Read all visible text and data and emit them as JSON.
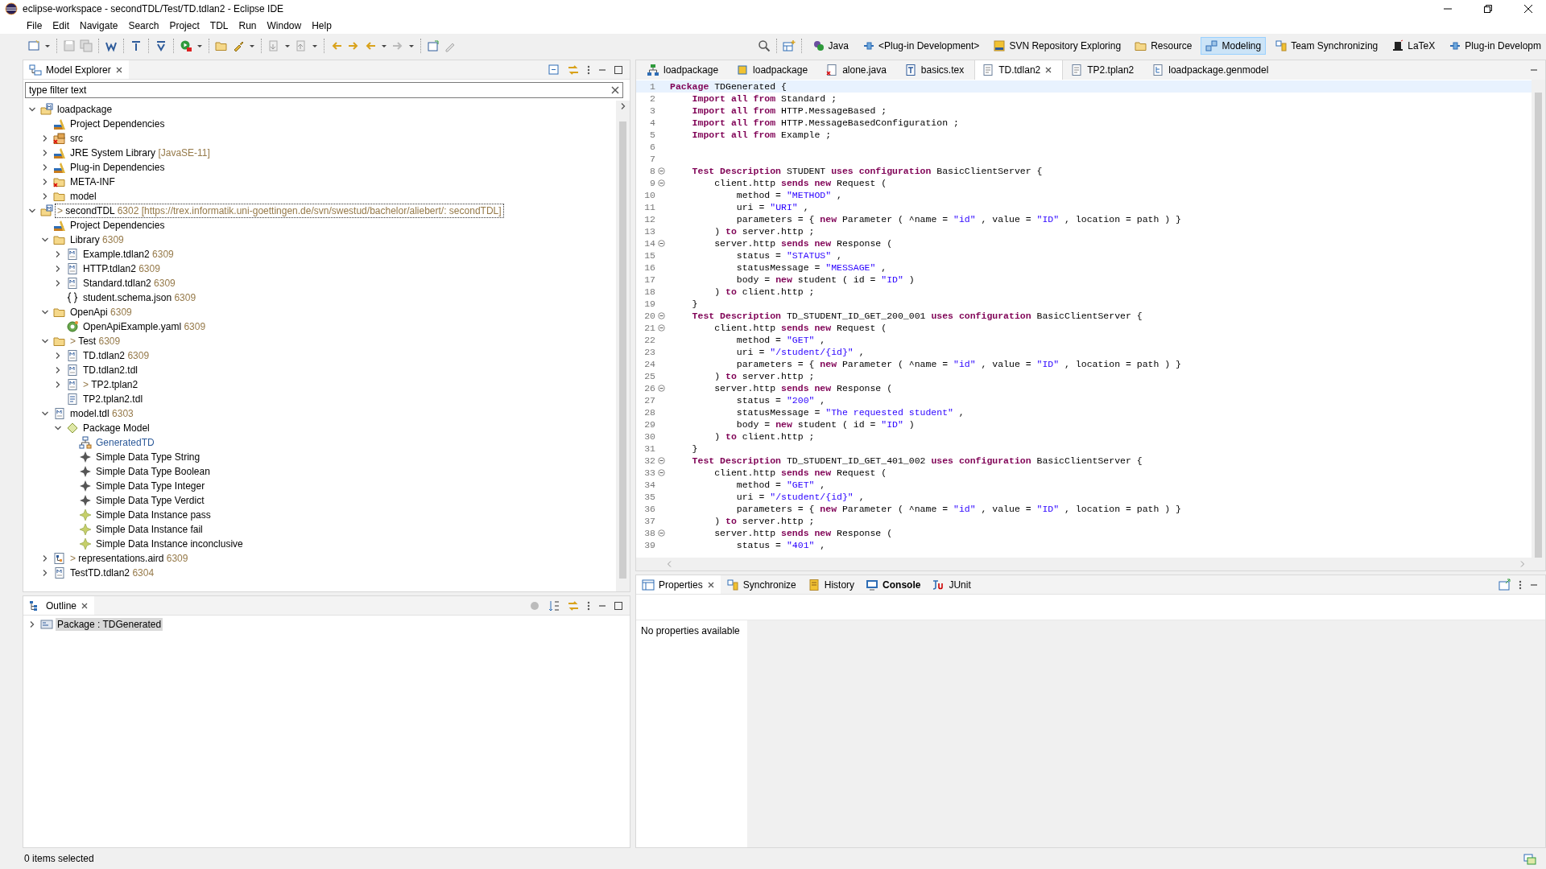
{
  "window": {
    "title": "eclipse-workspace - secondTDL/Test/TD.tdlan2 - Eclipse IDE"
  },
  "menu": [
    "File",
    "Edit",
    "Navigate",
    "Search",
    "Project",
    "TDL",
    "Run",
    "Window",
    "Help"
  ],
  "perspectives": [
    {
      "label": "Java",
      "selected": false
    },
    {
      "label": "<Plug-in Development>",
      "selected": false
    },
    {
      "label": "SVN Repository Exploring",
      "selected": false
    },
    {
      "label": "Resource",
      "selected": false
    },
    {
      "label": "Modeling",
      "selected": true
    },
    {
      "label": "Team Synchronizing",
      "selected": false
    },
    {
      "label": "LaTeX",
      "selected": false
    },
    {
      "label": "Plug-in Developm",
      "selected": false
    }
  ],
  "explorer": {
    "title": "Model Explorer",
    "filter": {
      "value": "type filter text"
    },
    "tree": [
      {
        "label": "loadpackage",
        "kind": "project",
        "has_children": true,
        "expanded": true,
        "selected": false,
        "children": [
          {
            "label": "Project Dependencies",
            "kind": "library",
            "has_children": false,
            "selected": false
          },
          {
            "label": "src",
            "kind": "src",
            "has_children": true,
            "expanded": false,
            "selected": false
          },
          {
            "label": "JRE System Library",
            "decoration": "[JavaSE-11]",
            "kind": "library",
            "has_children": true,
            "expanded": false,
            "selected": false
          },
          {
            "label": "Plug-in Dependencies",
            "kind": "library",
            "has_children": true,
            "expanded": false,
            "selected": false
          },
          {
            "label": "META-INF",
            "kind": "folder-error",
            "has_children": true,
            "expanded": false,
            "selected": false
          },
          {
            "label": "model",
            "kind": "folder",
            "has_children": true,
            "expanded": false,
            "selected": false
          }
        ]
      },
      {
        "label": "secondTDL",
        "marker": ">",
        "decoration": "6302 [https://trex.informatik.uni-goettingen.de/svn/swestud/bachelor/aliebert/: secondTDL]",
        "kind": "project",
        "has_children": true,
        "expanded": true,
        "selected": true,
        "children": [
          {
            "label": "Project Dependencies",
            "kind": "library",
            "has_children": false,
            "selected": false
          },
          {
            "label": "Library",
            "decoration": "6309",
            "kind": "folder",
            "has_children": true,
            "expanded": true,
            "selected": false,
            "children": [
              {
                "label": "Example.tdlan2",
                "decoration": "6309",
                "kind": "model",
                "has_children": true,
                "expanded": false,
                "selected": false
              },
              {
                "label": "HTTP.tdlan2",
                "decoration": "6309",
                "kind": "model",
                "has_children": true,
                "expanded": false,
                "selected": false
              },
              {
                "label": "Standard.tdlan2",
                "decoration": "6309",
                "kind": "model",
                "has_children": true,
                "expanded": false,
                "selected": false
              },
              {
                "label": "student.schema.json",
                "decoration": "6309",
                "kind": "json",
                "has_children": false,
                "selected": false
              }
            ]
          },
          {
            "label": "OpenApi",
            "decoration": "6309",
            "kind": "folder",
            "has_children": true,
            "expanded": true,
            "selected": false,
            "children": [
              {
                "label": "OpenApiExample.yaml",
                "decoration": "6309",
                "kind": "yaml",
                "has_children": false,
                "selected": false
              }
            ]
          },
          {
            "label": "Test",
            "marker": ">",
            "decoration": "6309",
            "kind": "folder",
            "has_children": true,
            "expanded": true,
            "selected": false,
            "children": [
              {
                "label": "TD.tdlan2",
                "decoration": "6309",
                "kind": "model",
                "has_children": true,
                "expanded": false,
                "selected": false
              },
              {
                "label": "TD.tdlan2.tdl",
                "kind": "model",
                "has_children": true,
                "expanded": false,
                "selected": false
              },
              {
                "label": "TP2.tplan2",
                "marker": ">",
                "kind": "model",
                "has_children": true,
                "expanded": false,
                "selected": false
              },
              {
                "label": "TP2.tplan2.tdl",
                "kind": "text",
                "has_children": false,
                "selected": false
              }
            ]
          },
          {
            "label": "model.tdl",
            "decoration": "6303",
            "kind": "model",
            "has_children": true,
            "expanded": true,
            "selected": false,
            "children": [
              {
                "label": "Package Model",
                "kind": "package",
                "has_children": true,
                "expanded": true,
                "selected": false,
                "children": [
                  {
                    "label": "GeneratedTD",
                    "kind": "diagram",
                    "has_children": false,
                    "selected": false
                  },
                  {
                    "label": "Simple Data Type String",
                    "kind": "datatype",
                    "has_children": false,
                    "selected": false
                  },
                  {
                    "label": "Simple Data Type Boolean",
                    "kind": "datatype",
                    "has_children": false,
                    "selected": false
                  },
                  {
                    "label": "Simple Data Type Integer",
                    "kind": "datatype",
                    "has_children": false,
                    "selected": false
                  },
                  {
                    "label": "Simple Data Type Verdict",
                    "kind": "datatype",
                    "has_children": false,
                    "selected": false
                  },
                  {
                    "label": "Simple Data Instance pass",
                    "kind": "instance",
                    "has_children": false,
                    "selected": false
                  },
                  {
                    "label": "Simple Data Instance fail",
                    "kind": "instance",
                    "has_children": false,
                    "selected": false
                  },
                  {
                    "label": "Simple Data Instance inconclusive",
                    "kind": "instance",
                    "has_children": false,
                    "selected": false
                  }
                ]
              }
            ]
          },
          {
            "label": "representations.aird",
            "marker": ">",
            "decoration": "6309",
            "kind": "aird",
            "has_children": true,
            "expanded": false,
            "selected": false
          },
          {
            "label": "TestTD.tdlan2",
            "decoration": "6304",
            "kind": "model",
            "has_children": true,
            "expanded": false,
            "selected": false
          }
        ]
      }
    ]
  },
  "outline": {
    "title": "Outline",
    "tree": [
      {
        "label": "Package : TDGenerated",
        "kind": "package-node",
        "has_children": true,
        "expanded": false,
        "selected": true
      }
    ]
  },
  "editor": {
    "tabs": [
      {
        "label": "loadpackage",
        "selected": false
      },
      {
        "label": "loadpackage",
        "selected": false
      },
      {
        "label": "alone.java",
        "selected": false
      },
      {
        "label": "basics.tex",
        "selected": false
      },
      {
        "label": "TD.tdlan2",
        "selected": true
      },
      {
        "label": "TP2.tplan2",
        "selected": false
      },
      {
        "label": "loadpackage.genmodel",
        "selected": false
      }
    ],
    "lines": [
      {
        "number": "1",
        "current": true,
        "foldable": false,
        "tokens": [
          {
            "kind": "kw",
            "text": "Package"
          },
          {
            "kind": "plain",
            "text": " TDGenerated {"
          }
        ]
      },
      {
        "number": "2",
        "current": false,
        "foldable": false,
        "tokens": [
          {
            "kind": "kw",
            "text": "    Import all from"
          },
          {
            "kind": "plain",
            "text": " Standard ;"
          }
        ]
      },
      {
        "number": "3",
        "current": false,
        "foldable": false,
        "tokens": [
          {
            "kind": "kw",
            "text": "    Import all from"
          },
          {
            "kind": "plain",
            "text": " HTTP.MessageBased ;"
          }
        ]
      },
      {
        "number": "4",
        "current": false,
        "foldable": false,
        "tokens": [
          {
            "kind": "kw",
            "text": "    Import all from"
          },
          {
            "kind": "plain",
            "text": " HTTP.MessageBasedConfiguration ;"
          }
        ]
      },
      {
        "number": "5",
        "current": false,
        "foldable": false,
        "tokens": [
          {
            "kind": "kw",
            "text": "    Import all from"
          },
          {
            "kind": "plain",
            "text": " Example ;"
          }
        ]
      },
      {
        "number": "6",
        "current": false,
        "foldable": false
      },
      {
        "number": "7",
        "current": false,
        "foldable": false
      },
      {
        "number": "8",
        "current": false,
        "foldable": true,
        "tokens": [
          {
            "kind": "kw",
            "text": "    Test Description"
          },
          {
            "kind": "plain",
            "text": " STUDENT "
          },
          {
            "kind": "kw",
            "text": "uses configuration"
          },
          {
            "kind": "plain",
            "text": " BasicClientServer {"
          }
        ]
      },
      {
        "number": "9",
        "current": false,
        "foldable": true,
        "tokens": [
          {
            "kind": "plain",
            "text": "        client.http "
          },
          {
            "kind": "kw",
            "text": "sends new"
          },
          {
            "kind": "plain",
            "text": " Request ("
          }
        ]
      },
      {
        "number": "10",
        "current": false,
        "foldable": false,
        "tokens": [
          {
            "kind": "plain",
            "text": "            method = "
          },
          {
            "kind": "str",
            "text": "\"METHOD\""
          },
          {
            "kind": "plain",
            "text": " ,"
          }
        ]
      },
      {
        "number": "11",
        "current": false,
        "foldable": false,
        "tokens": [
          {
            "kind": "plain",
            "text": "            uri = "
          },
          {
            "kind": "str",
            "text": "\"URI\""
          },
          {
            "kind": "plain",
            "text": " ,"
          }
        ]
      },
      {
        "number": "12",
        "current": false,
        "foldable": false,
        "tokens": [
          {
            "kind": "plain",
            "text": "            parameters = { "
          },
          {
            "kind": "kw",
            "text": "new"
          },
          {
            "kind": "plain",
            "text": " Parameter ( ^name = "
          },
          {
            "kind": "str",
            "text": "\"id\""
          },
          {
            "kind": "plain",
            "text": " , value = "
          },
          {
            "kind": "str",
            "text": "\"ID\""
          },
          {
            "kind": "plain",
            "text": " , location = path ) }"
          }
        ]
      },
      {
        "number": "13",
        "current": false,
        "foldable": false,
        "tokens": [
          {
            "kind": "plain",
            "text": "        ) "
          },
          {
            "kind": "kw",
            "text": "to"
          },
          {
            "kind": "plain",
            "text": " server.http ;"
          }
        ]
      },
      {
        "number": "14",
        "current": false,
        "foldable": true,
        "tokens": [
          {
            "kind": "plain",
            "text": "        server.http "
          },
          {
            "kind": "kw",
            "text": "sends new"
          },
          {
            "kind": "plain",
            "text": " Response ("
          }
        ]
      },
      {
        "number": "15",
        "current": false,
        "foldable": false,
        "tokens": [
          {
            "kind": "plain",
            "text": "            status = "
          },
          {
            "kind": "str",
            "text": "\"STATUS\""
          },
          {
            "kind": "plain",
            "text": " ,"
          }
        ]
      },
      {
        "number": "16",
        "current": false,
        "foldable": false,
        "tokens": [
          {
            "kind": "plain",
            "text": "            statusMessage = "
          },
          {
            "kind": "str",
            "text": "\"MESSAGE\""
          },
          {
            "kind": "plain",
            "text": " ,"
          }
        ]
      },
      {
        "number": "17",
        "current": false,
        "foldable": false,
        "tokens": [
          {
            "kind": "plain",
            "text": "            body = "
          },
          {
            "kind": "kw",
            "text": "new"
          },
          {
            "kind": "plain",
            "text": " student ( id = "
          },
          {
            "kind": "str",
            "text": "\"ID\""
          },
          {
            "kind": "plain",
            "text": " )"
          }
        ]
      },
      {
        "number": "18",
        "current": false,
        "foldable": false,
        "tokens": [
          {
            "kind": "plain",
            "text": "        ) "
          },
          {
            "kind": "kw",
            "text": "to"
          },
          {
            "kind": "plain",
            "text": " client.http ;"
          }
        ]
      },
      {
        "number": "19",
        "current": false,
        "foldable": false,
        "tokens": [
          {
            "kind": "plain",
            "text": "    }"
          }
        ]
      },
      {
        "number": "20",
        "current": false,
        "foldable": true,
        "tokens": [
          {
            "kind": "kw",
            "text": "    Test Description"
          },
          {
            "kind": "plain",
            "text": " TD_STUDENT_ID_GET_200_001 "
          },
          {
            "kind": "kw",
            "text": "uses configuration"
          },
          {
            "kind": "plain",
            "text": " BasicClientServer {"
          }
        ]
      },
      {
        "number": "21",
        "current": false,
        "foldable": true,
        "tokens": [
          {
            "kind": "plain",
            "text": "        client.http "
          },
          {
            "kind": "kw",
            "text": "sends new"
          },
          {
            "kind": "plain",
            "text": " Request ("
          }
        ]
      },
      {
        "number": "22",
        "current": false,
        "foldable": false,
        "tokens": [
          {
            "kind": "plain",
            "text": "            method = "
          },
          {
            "kind": "str",
            "text": "\"GET\""
          },
          {
            "kind": "plain",
            "text": " ,"
          }
        ]
      },
      {
        "number": "23",
        "current": false,
        "foldable": false,
        "tokens": [
          {
            "kind": "plain",
            "text": "            uri = "
          },
          {
            "kind": "str",
            "text": "\"/student/{id}\""
          },
          {
            "kind": "plain",
            "text": " ,"
          }
        ]
      },
      {
        "number": "24",
        "current": false,
        "foldable": false,
        "tokens": [
          {
            "kind": "plain",
            "text": "            parameters = { "
          },
          {
            "kind": "kw",
            "text": "new"
          },
          {
            "kind": "plain",
            "text": " Parameter ( ^name = "
          },
          {
            "kind": "str",
            "text": "\"id\""
          },
          {
            "kind": "plain",
            "text": " , value = "
          },
          {
            "kind": "str",
            "text": "\"ID\""
          },
          {
            "kind": "plain",
            "text": " , location = path ) }"
          }
        ]
      },
      {
        "number": "25",
        "current": false,
        "foldable": false,
        "tokens": [
          {
            "kind": "plain",
            "text": "        ) "
          },
          {
            "kind": "kw",
            "text": "to"
          },
          {
            "kind": "plain",
            "text": " server.http ;"
          }
        ]
      },
      {
        "number": "26",
        "current": false,
        "foldable": true,
        "tokens": [
          {
            "kind": "plain",
            "text": "        server.http "
          },
          {
            "kind": "kw",
            "text": "sends new"
          },
          {
            "kind": "plain",
            "text": " Response ("
          }
        ]
      },
      {
        "number": "27",
        "current": false,
        "foldable": false,
        "tokens": [
          {
            "kind": "plain",
            "text": "            status = "
          },
          {
            "kind": "str",
            "text": "\"200\""
          },
          {
            "kind": "plain",
            "text": " ,"
          }
        ]
      },
      {
        "number": "28",
        "current": false,
        "foldable": false,
        "tokens": [
          {
            "kind": "plain",
            "text": "            statusMessage = "
          },
          {
            "kind": "str",
            "text": "\"The requested student\""
          },
          {
            "kind": "plain",
            "text": " ,"
          }
        ]
      },
      {
        "number": "29",
        "current": false,
        "foldable": false,
        "tokens": [
          {
            "kind": "plain",
            "text": "            body = "
          },
          {
            "kind": "kw",
            "text": "new"
          },
          {
            "kind": "plain",
            "text": " student ( id = "
          },
          {
            "kind": "str",
            "text": "\"ID\""
          },
          {
            "kind": "plain",
            "text": " )"
          }
        ]
      },
      {
        "number": "30",
        "current": false,
        "foldable": false,
        "tokens": [
          {
            "kind": "plain",
            "text": "        ) "
          },
          {
            "kind": "kw",
            "text": "to"
          },
          {
            "kind": "plain",
            "text": " client.http ;"
          }
        ]
      },
      {
        "number": "31",
        "current": false,
        "foldable": false,
        "tokens": [
          {
            "kind": "plain",
            "text": "    }"
          }
        ]
      },
      {
        "number": "32",
        "current": false,
        "foldable": true,
        "tokens": [
          {
            "kind": "kw",
            "text": "    Test Description"
          },
          {
            "kind": "plain",
            "text": " TD_STUDENT_ID_GET_401_002 "
          },
          {
            "kind": "kw",
            "text": "uses configuration"
          },
          {
            "kind": "plain",
            "text": " BasicClientServer {"
          }
        ]
      },
      {
        "number": "33",
        "current": false,
        "foldable": true,
        "tokens": [
          {
            "kind": "plain",
            "text": "        client.http "
          },
          {
            "kind": "kw",
            "text": "sends new"
          },
          {
            "kind": "plain",
            "text": " Request ("
          }
        ]
      },
      {
        "number": "34",
        "current": false,
        "foldable": false,
        "tokens": [
          {
            "kind": "plain",
            "text": "            method = "
          },
          {
            "kind": "str",
            "text": "\"GET\""
          },
          {
            "kind": "plain",
            "text": " ,"
          }
        ]
      },
      {
        "number": "35",
        "current": false,
        "foldable": false,
        "tokens": [
          {
            "kind": "plain",
            "text": "            uri = "
          },
          {
            "kind": "str",
            "text": "\"/student/{id}\""
          },
          {
            "kind": "plain",
            "text": " ,"
          }
        ]
      },
      {
        "number": "36",
        "current": false,
        "foldable": false,
        "tokens": [
          {
            "kind": "plain",
            "text": "            parameters = { "
          },
          {
            "kind": "kw",
            "text": "new"
          },
          {
            "kind": "plain",
            "text": " Parameter ( ^name = "
          },
          {
            "kind": "str",
            "text": "\"id\""
          },
          {
            "kind": "plain",
            "text": " , value = "
          },
          {
            "kind": "str",
            "text": "\"ID\""
          },
          {
            "kind": "plain",
            "text": " , location = path ) }"
          }
        ]
      },
      {
        "number": "37",
        "current": false,
        "foldable": false,
        "tokens": [
          {
            "kind": "plain",
            "text": "        ) "
          },
          {
            "kind": "kw",
            "text": "to"
          },
          {
            "kind": "plain",
            "text": " server.http ;"
          }
        ]
      },
      {
        "number": "38",
        "current": false,
        "foldable": true,
        "tokens": [
          {
            "kind": "plain",
            "text": "        server.http "
          },
          {
            "kind": "kw",
            "text": "sends new"
          },
          {
            "kind": "plain",
            "text": " Response ("
          }
        ]
      },
      {
        "number": "39",
        "current": false,
        "foldable": false,
        "tokens": [
          {
            "kind": "plain",
            "text": "            status = "
          },
          {
            "kind": "str",
            "text": "\"401\""
          },
          {
            "kind": "plain",
            "text": " ,"
          }
        ]
      }
    ]
  },
  "bottom_panel": {
    "tabs": [
      {
        "label": "Properties",
        "selected": true,
        "highlighted": false
      },
      {
        "label": "Synchronize",
        "selected": false,
        "highlighted": false
      },
      {
        "label": "History",
        "selected": false,
        "highlighted": false
      },
      {
        "label": "Console",
        "selected": false,
        "highlighted": true
      },
      {
        "label": "JUnit",
        "selected": false,
        "highlighted": false
      }
    ],
    "message": "No properties available"
  },
  "status_bar": {
    "text": "0 items selected"
  }
}
